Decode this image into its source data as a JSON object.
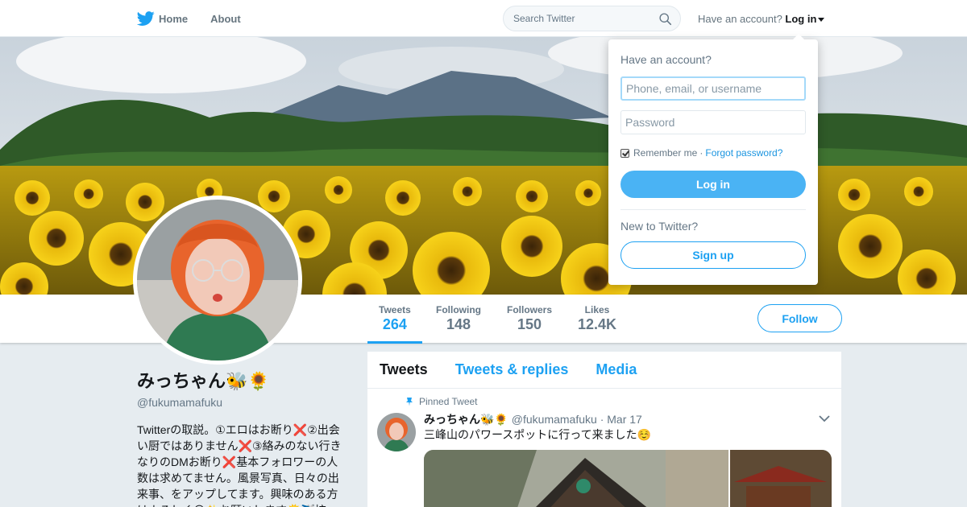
{
  "nav": {
    "home_label": "Home",
    "about_label": "About",
    "search_placeholder": "Search Twitter",
    "have_account": "Have an account?",
    "login_label": "Log in"
  },
  "profile": {
    "name": "みっちゃん🐝🌻",
    "handle": "@fukumamafuku",
    "bio": "Twitterの取説。①エロはお断り❌②出会い厨ではありません❌③絡みのない行きなりのDMお断り❌基本フォロワーの人数は求めてません。風景写真、日々の出来事、をアップしてます。興味のある方はよろしく😃✨お願いします🌞✈️拡"
  },
  "stats": [
    {
      "label": "Tweets",
      "value": "264",
      "active": true
    },
    {
      "label": "Following",
      "value": "148"
    },
    {
      "label": "Followers",
      "value": "150"
    },
    {
      "label": "Likes",
      "value": "12.4K"
    }
  ],
  "follow_label": "Follow",
  "timeline": {
    "tabs": [
      "Tweets",
      "Tweets & replies",
      "Media"
    ],
    "pinned_label": "Pinned Tweet",
    "tweet": {
      "name": "みっちゃん🐝🌻",
      "handle": "@fukumamafuku",
      "separator": "·",
      "date": "Mar 17",
      "text": "三峰山のパワースポットに行って来ました☺️"
    }
  },
  "login_dropdown": {
    "title": "Have an account?",
    "username_placeholder": "Phone, email, or username",
    "password_placeholder": "Password",
    "remember_label": "Remember me",
    "separator": "·",
    "forgot_label": "Forgot password?",
    "login_button": "Log in",
    "new_label": "New to Twitter?",
    "signup_button": "Sign up"
  },
  "colors": {
    "accent": "#1da1f2",
    "login_button": "#4ab3f4",
    "background": "#e6ecf0"
  },
  "icons": [
    "twitter-bird-icon",
    "search-icon",
    "caret-down-icon",
    "pin-icon",
    "chevron-down-icon",
    "checkbox-checked-icon"
  ]
}
